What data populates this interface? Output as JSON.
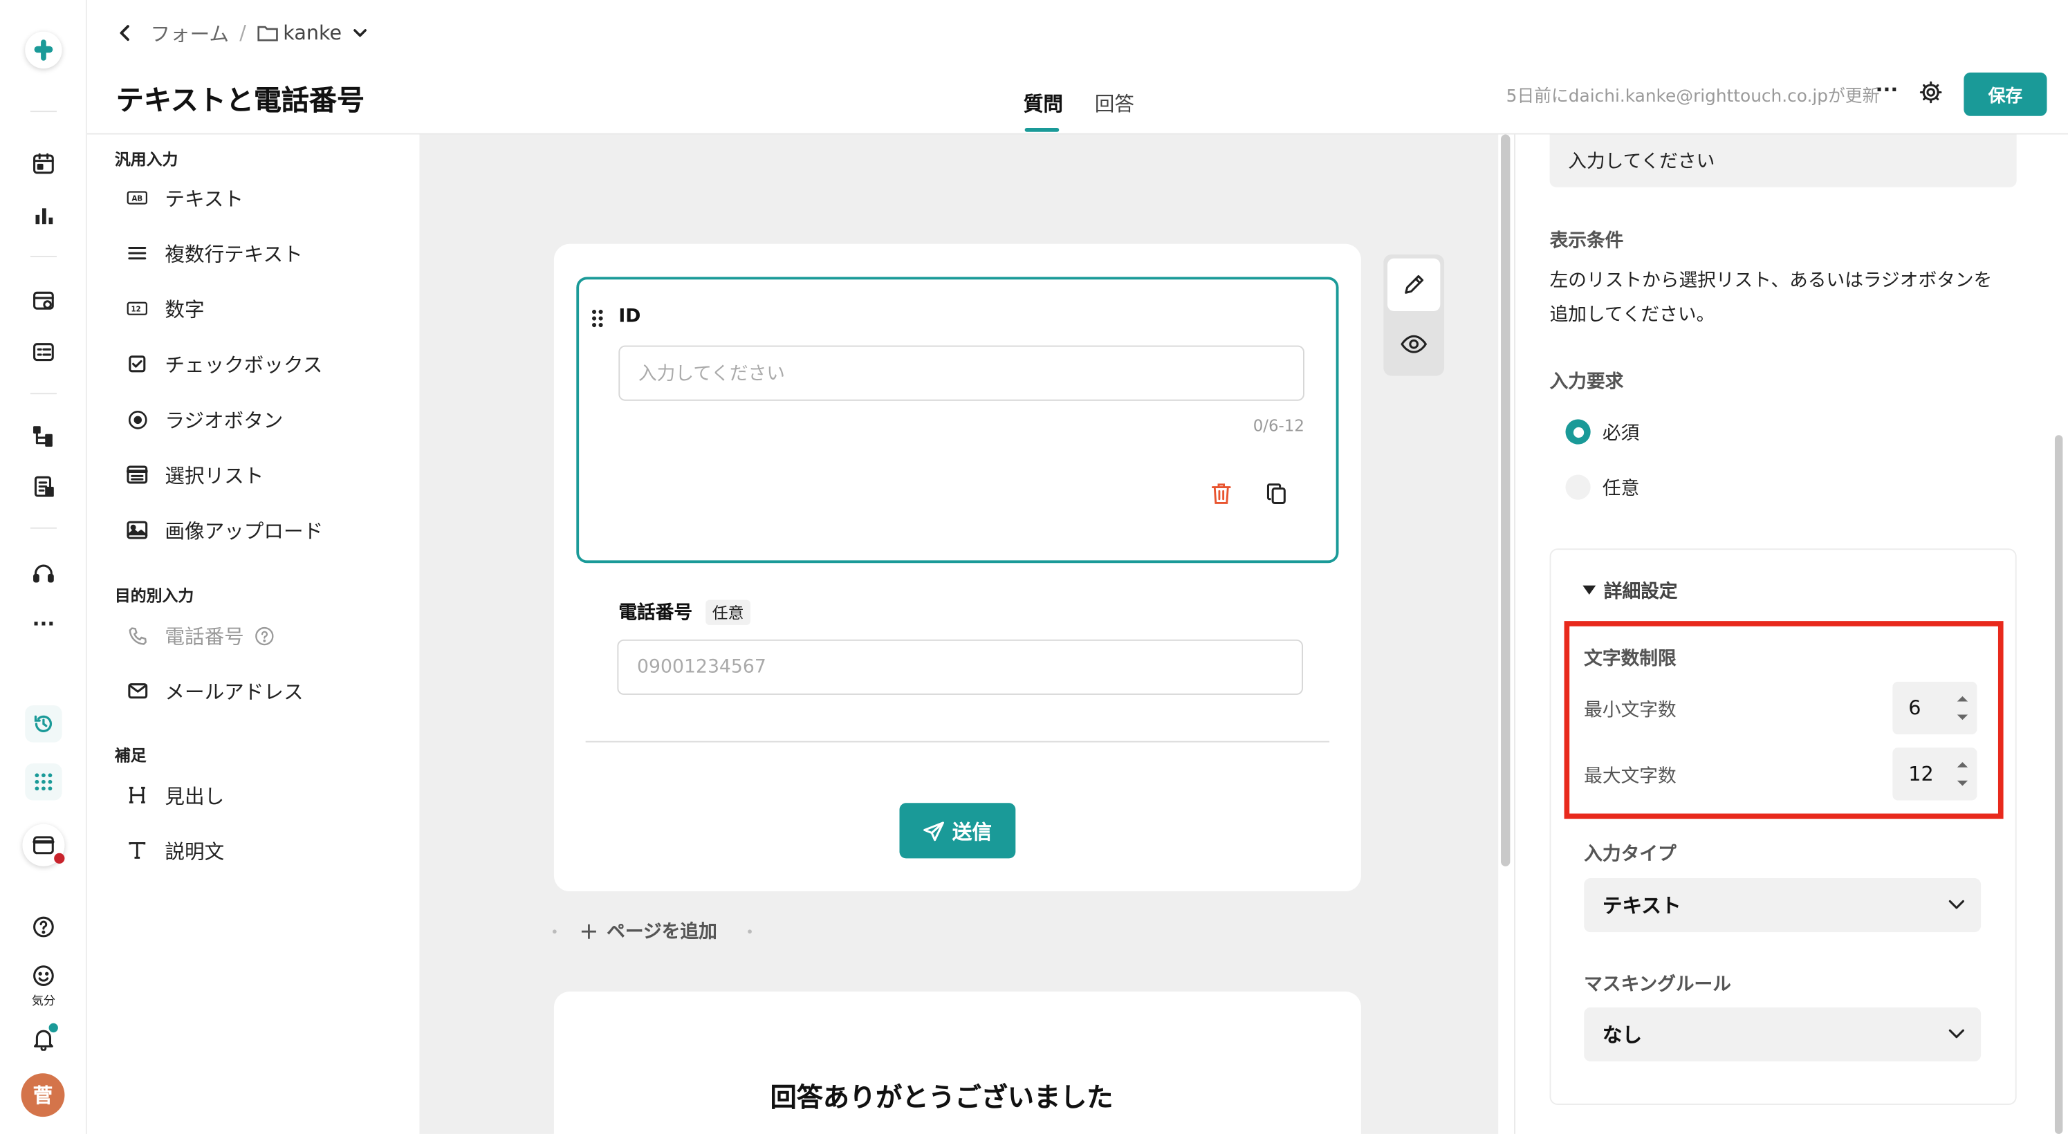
{
  "header": {
    "back_label": "フォーム",
    "separator": "/",
    "folder": "kanke",
    "title": "テキストと電話番号",
    "tabs": [
      "質問",
      "回答"
    ],
    "updated": "5日前にdaichi.kanke@righttouch.co.jpが更新",
    "more": "···",
    "save": "保存"
  },
  "rail": {
    "mood_label": "気分",
    "avatar": "菅",
    "more": "···",
    "icons": [
      "app-logo-icon",
      "calendar-icon",
      "bar-chart-icon",
      "form-settings-icon",
      "form-list-icon",
      "flow-icon",
      "document-icon",
      "headset-icon",
      "more-icon",
      "history-icon",
      "apps-grid-icon",
      "window-icon",
      "help-icon",
      "mood-icon",
      "bell-icon"
    ]
  },
  "palette": {
    "sections": [
      {
        "title": "汎用入力",
        "items": [
          {
            "label": "テキスト",
            "icon": "text-field-icon"
          },
          {
            "label": "複数行テキスト",
            "icon": "multiline-icon"
          },
          {
            "label": "数字",
            "icon": "number-field-icon"
          },
          {
            "label": "チェックボックス",
            "icon": "checkbox-icon"
          },
          {
            "label": "ラジオボタン",
            "icon": "radio-icon"
          },
          {
            "label": "選択リスト",
            "icon": "select-list-icon"
          },
          {
            "label": "画像アップロード",
            "icon": "image-icon"
          }
        ]
      },
      {
        "title": "目的別入力",
        "items": [
          {
            "label": "電話番号",
            "icon": "phone-icon"
          },
          {
            "label": "メールアドレス",
            "icon": "mail-icon"
          }
        ]
      },
      {
        "title": "補足",
        "items": [
          {
            "label": "見出し",
            "icon": "heading-icon"
          },
          {
            "label": "説明文",
            "icon": "description-icon"
          }
        ]
      }
    ]
  },
  "form": {
    "field1": {
      "label": "ID",
      "placeholder": "入力してください",
      "counter": "0/6-12"
    },
    "field2": {
      "label": "電話番号",
      "badge": "任意",
      "placeholder": "09001234567"
    },
    "send": "送信",
    "add_page": "ページを追加",
    "thanks": "回答ありがとうございました"
  },
  "right": {
    "placeholder_value": "入力してください",
    "display_condition": {
      "label": "表示条件",
      "text1": "左のリストから選択リスト、あるいはラジオボタンを",
      "text2": "追加してください。"
    },
    "required": {
      "label": "入力要求",
      "options": [
        "必須",
        "任意"
      ],
      "selected": "必須"
    },
    "details": {
      "title": "詳細設定",
      "char_limit": {
        "title": "文字数制限",
        "min_label": "最小文字数",
        "min": "6",
        "max_label": "最大文字数",
        "max": "12"
      },
      "input_type": {
        "label": "入力タイプ",
        "value": "テキスト"
      },
      "masking": {
        "label": "マスキングルール",
        "value": "なし"
      }
    }
  },
  "colors": {
    "accent": "#1a9a98",
    "highlight": "#e8291c",
    "delete": "#e8542f"
  }
}
